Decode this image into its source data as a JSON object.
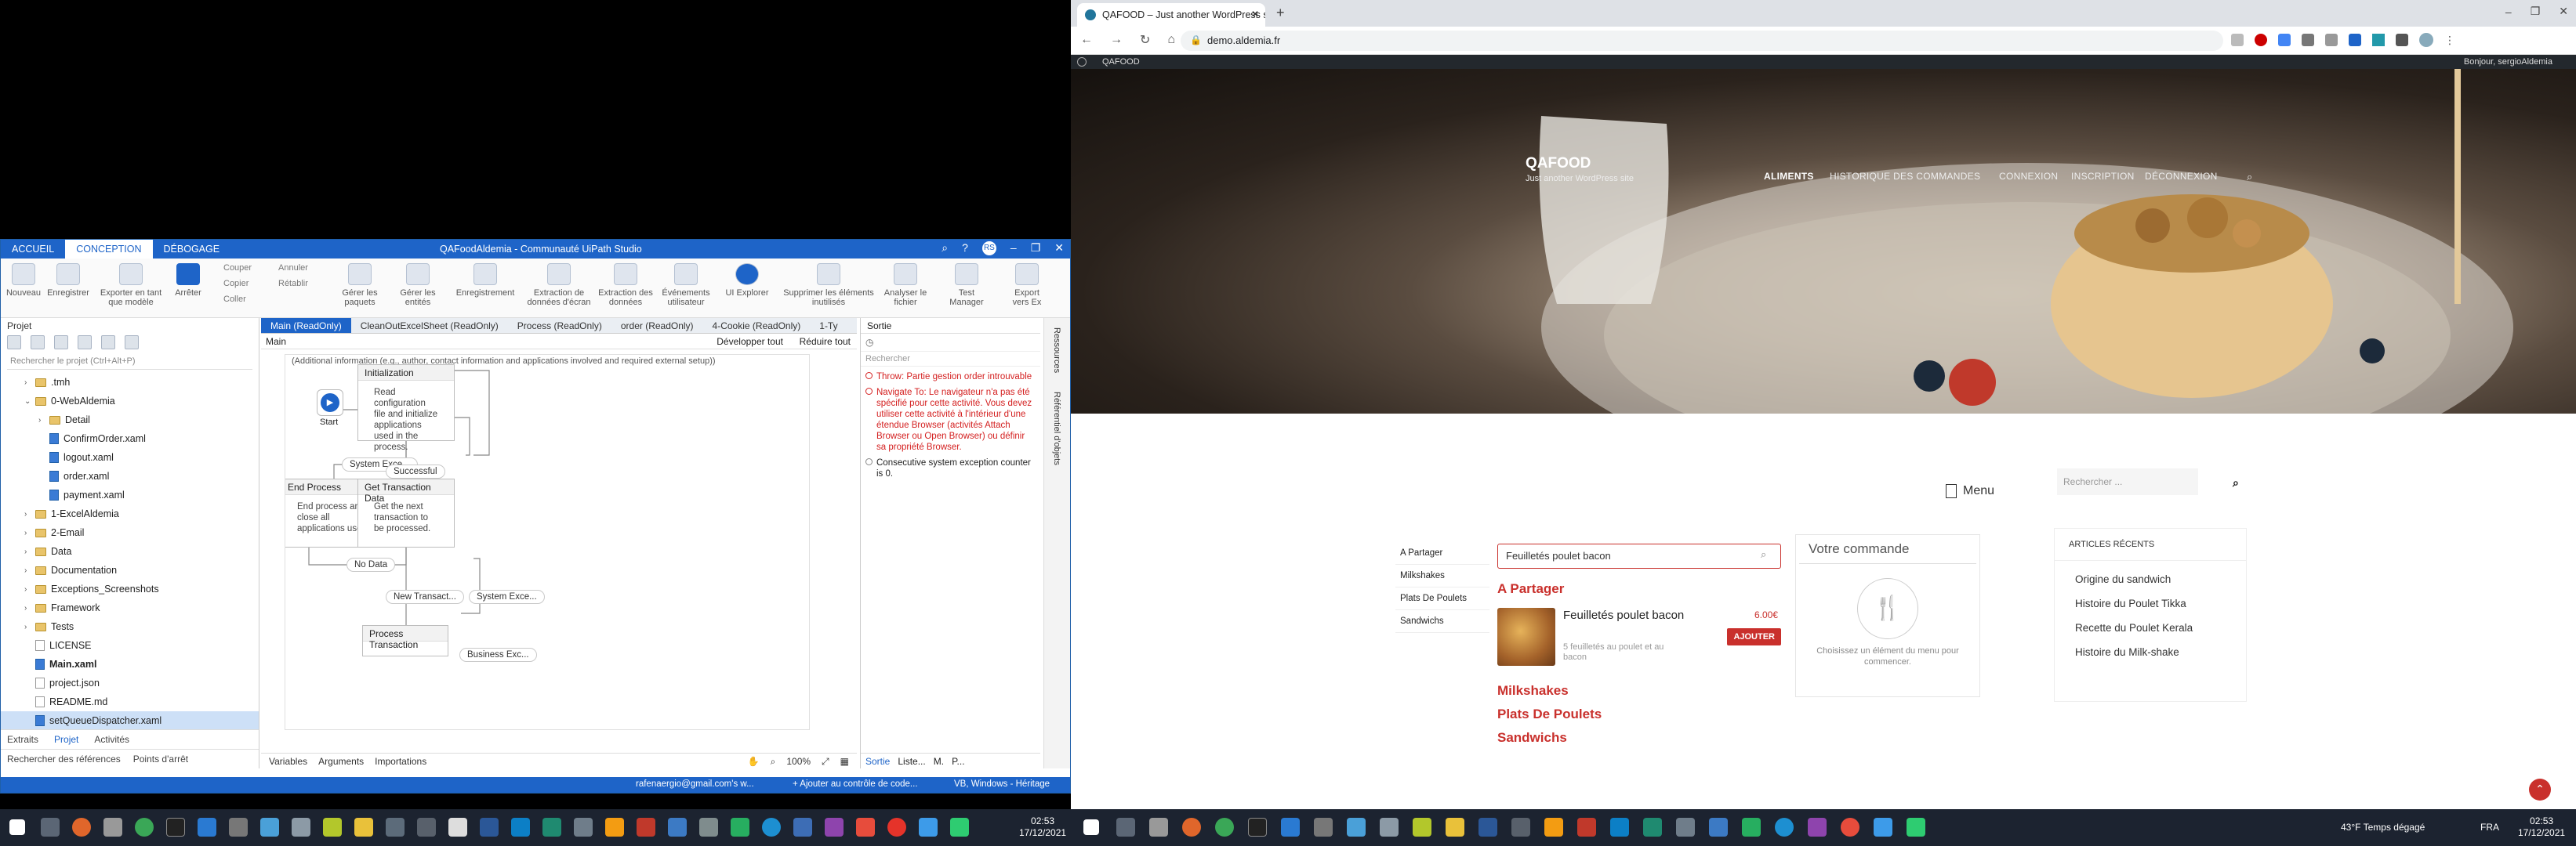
{
  "studio": {
    "tabs": [
      "ACCUEIL",
      "CONCEPTION",
      "DÉBOGAGE"
    ],
    "title": "QAFoodAldemia - Communauté UiPath Studio",
    "avatar": "RS",
    "ribbon": {
      "new": "Nouveau",
      "save": "Enregistrer",
      "export": "Exporter en tant que modèle",
      "stop": "Arrêter",
      "cut": "Couper",
      "copy": "Copier",
      "paste": "Coller",
      "undo": "Annuler",
      "redo": "Rétablir",
      "packages": "Gérer les paquets",
      "entities": "Gérer les entités",
      "record": "Enregistrement",
      "screen": "Extraction de données d'écran",
      "data_extract": "Extraction des données",
      "events": "Événements utilisateur",
      "ui_explorer": "UI Explorer",
      "remove_vars": "Supprimer les éléments inutilisés",
      "analyze": "Analyser le fichier",
      "test_manager": "Test Manager",
      "export_excel": "Export vers Ex"
    },
    "project": {
      "header": "Projet",
      "search": "Rechercher le projet (Ctrl+Alt+P)",
      "tree": [
        {
          "indent": 1,
          "type": "folder",
          "label": ".tmh",
          "exp": "›"
        },
        {
          "indent": 1,
          "type": "folder",
          "label": "0-WebAldemia",
          "exp": "⌄"
        },
        {
          "indent": 2,
          "type": "folder",
          "label": "Detail",
          "exp": "›"
        },
        {
          "indent": 2,
          "type": "xaml",
          "label": "ConfirmOrder.xaml",
          "exp": ""
        },
        {
          "indent": 2,
          "type": "xaml",
          "label": "logout.xaml",
          "exp": ""
        },
        {
          "indent": 2,
          "type": "xaml",
          "label": "order.xaml",
          "exp": ""
        },
        {
          "indent": 2,
          "type": "xaml",
          "label": "payment.xaml",
          "exp": ""
        },
        {
          "indent": 1,
          "type": "folder",
          "label": "1-ExcelAldemia",
          "exp": "›"
        },
        {
          "indent": 1,
          "type": "folder",
          "label": "2-Email",
          "exp": "›"
        },
        {
          "indent": 1,
          "type": "folder",
          "label": "Data",
          "exp": "›"
        },
        {
          "indent": 1,
          "type": "folder",
          "label": "Documentation",
          "exp": "›"
        },
        {
          "indent": 1,
          "type": "folder",
          "label": "Exceptions_Screenshots",
          "exp": "›"
        },
        {
          "indent": 1,
          "type": "folder",
          "label": "Framework",
          "exp": "›"
        },
        {
          "indent": 1,
          "type": "folder",
          "label": "Tests",
          "exp": "›"
        },
        {
          "indent": 1,
          "type": "file",
          "label": "LICENSE",
          "exp": ""
        },
        {
          "indent": 1,
          "type": "xaml",
          "label": "Main.xaml",
          "exp": "",
          "bold": true
        },
        {
          "indent": 1,
          "type": "file",
          "label": "project.json",
          "exp": ""
        },
        {
          "indent": 1,
          "type": "file",
          "label": "README.md",
          "exp": ""
        },
        {
          "indent": 1,
          "type": "xaml",
          "label": "setQueueDispatcher.xaml",
          "exp": "",
          "sel": true
        }
      ],
      "bottom_tabs": [
        "Extraits",
        "Projet",
        "Activités"
      ],
      "bottom2": [
        "Rechercher des références",
        "Points d'arrêt"
      ]
    },
    "doc_tabs": [
      "Main (ReadOnly)",
      "CleanOutExcelSheet (ReadOnly)",
      "Process (ReadOnly)",
      "order (ReadOnly)",
      "4-Cookie (ReadOnly)",
      "1-Ty"
    ],
    "breadcrumb": "Main",
    "expand": "Développer tout",
    "collapse": "Réduire tout",
    "annotation": "(Additional information (e.g., author, contact information and applications involved and required external setup))",
    "flow": {
      "start": "Start",
      "init_title": "Initialization",
      "init_body": "Read configuration file and initialize applications used in the process.",
      "end_title": "End Process",
      "end_body": "End process and close all applications used.",
      "get_title": "Get Transaction Data",
      "get_body": "Get the next transaction to be processed.",
      "proc_title": "Process Transaction",
      "l_sysexc": "System Exce...",
      "l_success": "Successful",
      "l_nodata": "No Data",
      "l_newtx": "New Transact...",
      "l_sysexc2": "System Exce...",
      "l_bizexc": "Business Exc..."
    },
    "designer_bottom": [
      "Variables",
      "Arguments",
      "Importations"
    ],
    "zoom": "100%",
    "output": {
      "header": "Sortie",
      "search": "Rechercher",
      "messages": [
        {
          "kind": "err",
          "text": "Throw: Partie gestion order introuvable"
        },
        {
          "kind": "err",
          "text": "Navigate To: Le navigateur n'a pas été spécifié pour cette activité. Vous devez utiliser cette activité à l'intérieur d'une étendue Browser (activités Attach Browser ou Open Browser) ou définir sa propriété Browser."
        },
        {
          "kind": "info",
          "text": "Consecutive system exception counter is 0."
        }
      ],
      "bottom_tabs": [
        "Sortie",
        "Liste...",
        "M.",
        "P..."
      ]
    },
    "right_tabs": [
      "Ressources",
      "Référentiel d'objets"
    ],
    "status": {
      "account": "rafenaergio@gmail.com's w...",
      "source": "+ Ajouter au contrôle de code...",
      "profile": "VB, Windows - Héritage"
    }
  },
  "left_taskbar": {
    "time": "02:53",
    "date": "17/12/2021"
  },
  "browser": {
    "tab_title": "QAFOOD – Just another WordPress site",
    "url": "demo.aldemia.fr",
    "wp_site": "QAFOOD",
    "wp_user": "Bonjour, sergioAldemia",
    "site_title": "QAFOOD",
    "tagline": "Just another WordPress site",
    "nav": [
      "ALIMENTS",
      "HISTORIQUE DES COMMANDES",
      "CONNEXION",
      "INSCRIPTION",
      "DÉCONNEXION"
    ],
    "menu_label": "Menu",
    "search_placeholder": "Rechercher ...",
    "categories": [
      "A Partager",
      "Milkshakes",
      "Plats De Poulets",
      "Sandwichs"
    ],
    "search_value": "Feuilletés poulet bacon",
    "section_title": "A Partager",
    "product": {
      "name": "Feuilletés poulet bacon",
      "desc": "5 feuilletés au poulet et au bacon",
      "price": "6.00€",
      "button": "AJOUTER"
    },
    "more_sections": [
      "Milkshakes",
      "Plats De Poulets",
      "Sandwichs"
    ],
    "order": {
      "title": "Votre commande",
      "empty": "Choisissez un élément du menu pour commencer."
    },
    "recent": {
      "title": "ARTICLES RÉCENTS",
      "items": [
        "Origine du sandwich",
        "Histoire du Poulet Tikka",
        "Recette du Poulet Kerala",
        "Histoire du Milk-shake"
      ]
    }
  },
  "right_taskbar": {
    "weather": "43°F Temps dégagé",
    "lang": "FRA",
    "time": "02:53",
    "date": "17/12/2021"
  }
}
